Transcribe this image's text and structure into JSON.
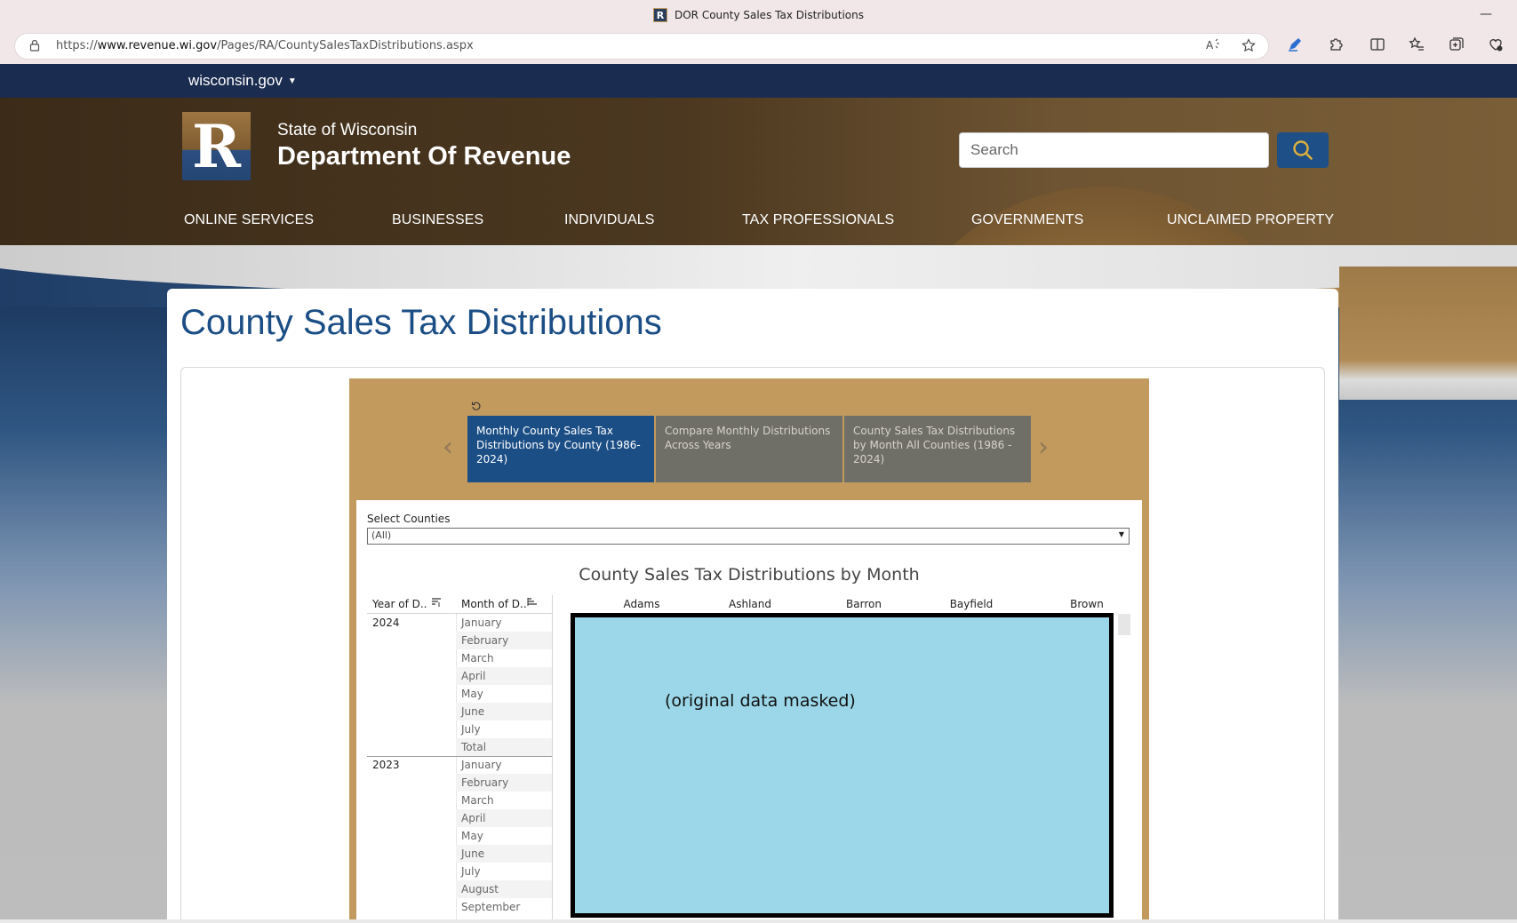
{
  "browser": {
    "tab_title": "DOR County Sales Tax Distributions",
    "favicon_letter": "R",
    "url_prefix": "https://",
    "url_host": "www.revenue.wi.gov",
    "url_path": "/Pages/RA/CountySalesTaxDistributions.aspx",
    "minimize_glyph": "—"
  },
  "site": {
    "topbar_label": "wisconsin.gov",
    "logo_letter": "R",
    "brand_small": "State of Wisconsin",
    "brand_big": "Department Of Revenue",
    "search_placeholder": "Search",
    "nav": [
      {
        "label": "ONLINE SERVICES"
      },
      {
        "label": "BUSINESSES"
      },
      {
        "label": "INDIVIDUALS"
      },
      {
        "label": "TAX PROFESSIONALS"
      },
      {
        "label": "GOVERNMENTS"
      },
      {
        "label": "UNCLAIMED PROPERTY"
      }
    ]
  },
  "page": {
    "title": "County Sales Tax Distributions"
  },
  "viz": {
    "tabs": [
      {
        "label": "Monthly County Sales Tax Distributions by County (1986-2024)",
        "active": true
      },
      {
        "label": "Compare Monthly Distributions Across Years",
        "active": false
      },
      {
        "label": "County Sales Tax Distributions by Month  All Counties (1986 - 2024)",
        "active": false
      }
    ],
    "filter_label": "Select Counties",
    "filter_value": "(All)",
    "title": "County Sales Tax Distributions by Month",
    "row_headers": {
      "year": "Year of D..",
      "month": "Month of D.."
    },
    "counties": [
      "Adams",
      "Ashland",
      "Barron",
      "Bayfield",
      "Brown"
    ],
    "groups": [
      {
        "year": "2024",
        "months": [
          "January",
          "February",
          "March",
          "April",
          "May",
          "June",
          "July",
          "Total"
        ]
      },
      {
        "year": "2023",
        "months": [
          "January",
          "February",
          "March",
          "April",
          "May",
          "June",
          "July",
          "August",
          "September"
        ]
      }
    ],
    "mask_text": "(original data masked)"
  },
  "colors": {
    "brand_blue": "#1b4e85",
    "topbar_navy": "#1a2c4f",
    "viz_gold": "#c29a5e",
    "mask_fill": "#9bd7e8"
  }
}
